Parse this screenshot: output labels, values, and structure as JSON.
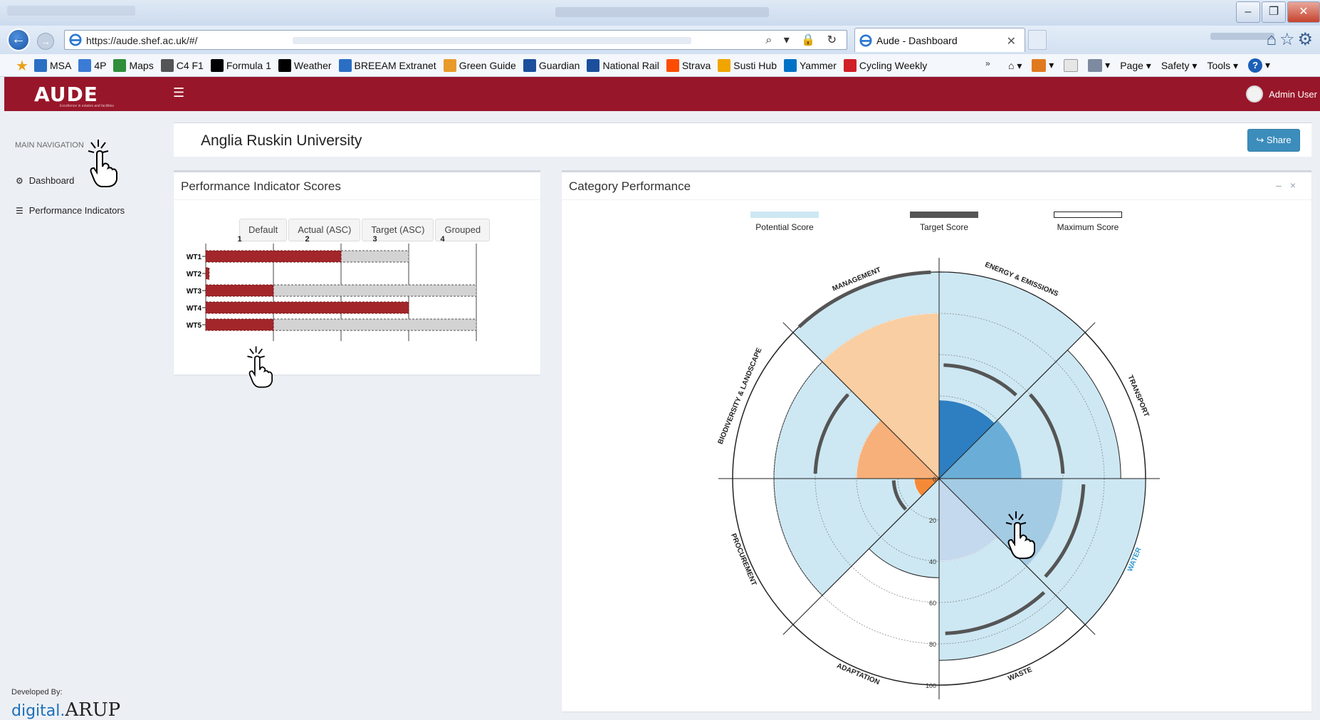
{
  "browser": {
    "url": "https://aude.shef.ac.uk/#/",
    "tab_title": "Aude - Dashboard",
    "favorites": [
      {
        "label": "MSA",
        "color": "#2a6fc4"
      },
      {
        "label": "4P",
        "color": "#3a7bd5"
      },
      {
        "label": "Maps",
        "color": "#2f8f3a"
      },
      {
        "label": "C4 F1",
        "color": "#555555"
      },
      {
        "label": "Formula 1",
        "color": "#000000"
      },
      {
        "label": "Weather",
        "color": "#000000"
      },
      {
        "label": "BREEAM Extranet",
        "color": "#2a6fc4"
      },
      {
        "label": "Green Guide",
        "color": "#e89b2a"
      },
      {
        "label": "Guardian",
        "color": "#1b4f9c"
      },
      {
        "label": "National Rail",
        "color": "#1b4f9c"
      },
      {
        "label": "Strava",
        "color": "#fc4c02"
      },
      {
        "label": "Susti Hub",
        "color": "#f0a500"
      },
      {
        "label": "Yammer",
        "color": "#0072c6"
      },
      {
        "label": "Cycling Weekly",
        "color": "#d01f26"
      }
    ],
    "command_bar": {
      "page": "Page",
      "safety": "Safety",
      "tools": "Tools"
    }
  },
  "header": {
    "logo": "AUDE",
    "tagline": "Excellence in estates and facilities",
    "menu_icon": "hamburger-icon",
    "user": "Admin User"
  },
  "sidebar": {
    "heading": "MAIN NAVIGATION",
    "items": [
      {
        "label": "Dashboard",
        "icon": "dashboard-icon"
      },
      {
        "label": "Performance Indicators",
        "icon": "list-icon"
      }
    ],
    "developed_by": "Developed By:",
    "brand_prefix": "digital.",
    "brand": "ARUP"
  },
  "page": {
    "title": "Anglia Ruskin University",
    "share_label": "Share"
  },
  "pi_box": {
    "title": "Performance Indicator Scores",
    "sort_buttons": [
      "Default",
      "Actual (ASC)",
      "Target (ASC)",
      "Grouped"
    ]
  },
  "cat_box": {
    "title": "Category Performance",
    "tools": [
      "–",
      "×"
    ],
    "legend": [
      {
        "label": "Potential Score",
        "style": "potential"
      },
      {
        "label": "Target Score",
        "style": "target"
      },
      {
        "label": "Maximum Score",
        "style": "maximum"
      }
    ]
  },
  "colors": {
    "brand": "#98162a",
    "bar_actual": "#a3262a",
    "bar_target": "#d3d3d3",
    "potential": "#cde8f3",
    "target_ring": "#555555",
    "share": "#3c8dbc"
  },
  "chart_data": [
    {
      "type": "bar",
      "orientation": "horizontal",
      "categories": [
        "WT1",
        "WT2",
        "WT3",
        "WT4",
        "WT5"
      ],
      "x_ticks": [
        "1",
        "2",
        "3",
        "4"
      ],
      "xlim": [
        0,
        4
      ],
      "series": [
        {
          "values": [
            2.0,
            0.05,
            1.0,
            3.0,
            1.0
          ]
        },
        {
          "values": [
            3.0,
            0.05,
            4.0,
            3.0,
            4.0
          ]
        }
      ]
    },
    {
      "type": "polar-area",
      "radial_ticks": [
        "0",
        "20",
        "40",
        "60",
        "80",
        "100"
      ],
      "rlim": [
        0,
        100
      ],
      "categories": [
        {
          "label": "ENERGY & EMISSIONS",
          "color": "#2d7fc1",
          "actual": 38,
          "target": 55,
          "potential": 100
        },
        {
          "label": "TRANSPORT",
          "color": "#6aaed8",
          "actual": 40,
          "target": 60,
          "potential": 88
        },
        {
          "label": "WATER",
          "color": "#a4cbe4",
          "actual": 60,
          "target": 70,
          "potential": 100
        },
        {
          "label": "WASTE",
          "color": "#c5d9ee",
          "actual": 40,
          "target": 75,
          "potential": 88
        },
        {
          "label": "ADAPTATION",
          "color": "#e25212",
          "actual": 0,
          "target": 0,
          "potential": 48
        },
        {
          "label": "PROCUREMENT",
          "color": "#f48a38",
          "actual": 12,
          "target": 22,
          "potential": 80
        },
        {
          "label": "BIODIVERSITY & LANDSCAPE",
          "color": "#f8b07a",
          "actual": 40,
          "target": 60,
          "potential": 80
        },
        {
          "label": "MANAGEMENT",
          "color": "#f9cea2",
          "actual": 80,
          "target": 100,
          "potential": 100
        }
      ]
    }
  ]
}
